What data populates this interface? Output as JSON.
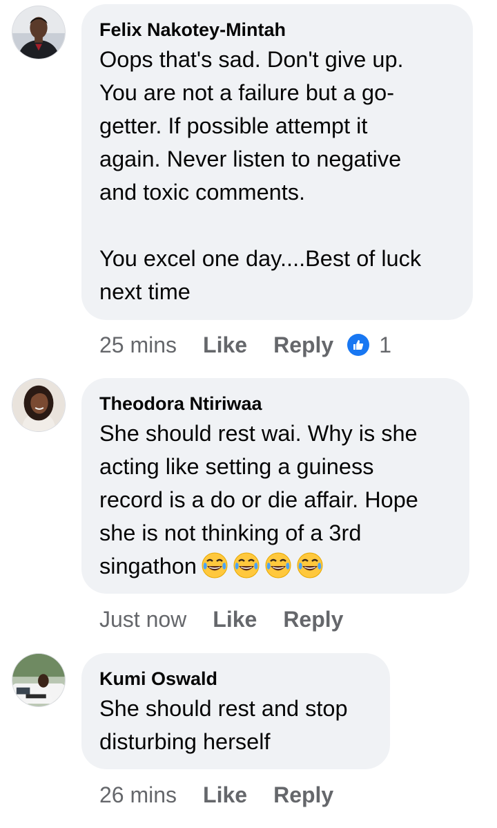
{
  "comments": [
    {
      "author": "Felix Nakotey-Mintah",
      "lines": [
        "Oops that's sad. Don't give up.",
        "You are not a failure but a go-",
        "getter. If possible attempt it",
        "again. Never listen to negative",
        "and toxic comments.",
        "",
        "You excel one day....Best of luck",
        "next time"
      ],
      "time": "25 mins",
      "like_label": "Like",
      "reply_label": "Reply",
      "reaction_icon": "like-reaction-icon",
      "reaction_count": "1"
    },
    {
      "author": "Theodora Ntiriwaa",
      "lines": [
        "She should rest wai. Why is she",
        "acting like setting a guiness",
        "record is a do or die affair. Hope",
        "she is not thinking of a 3rd",
        "singathon"
      ],
      "emoji": [
        "tears-of-joy-emoji",
        "tears-of-joy-emoji",
        "tears-of-joy-emoji",
        "tears-of-joy-emoji"
      ],
      "time": "Just now",
      "like_label": "Like",
      "reply_label": "Reply"
    },
    {
      "author": "Kumi Oswald",
      "lines": [
        "She should rest and stop",
        "disturbing herself"
      ],
      "time": "26 mins",
      "like_label": "Like",
      "reply_label": "Reply"
    }
  ],
  "colors": {
    "bubble": "#f0f2f5",
    "meta_text": "#65676b",
    "like_blue": "#1877f2",
    "emoji_yellow": "#ffc83d",
    "tears": "#4aa3f5"
  }
}
